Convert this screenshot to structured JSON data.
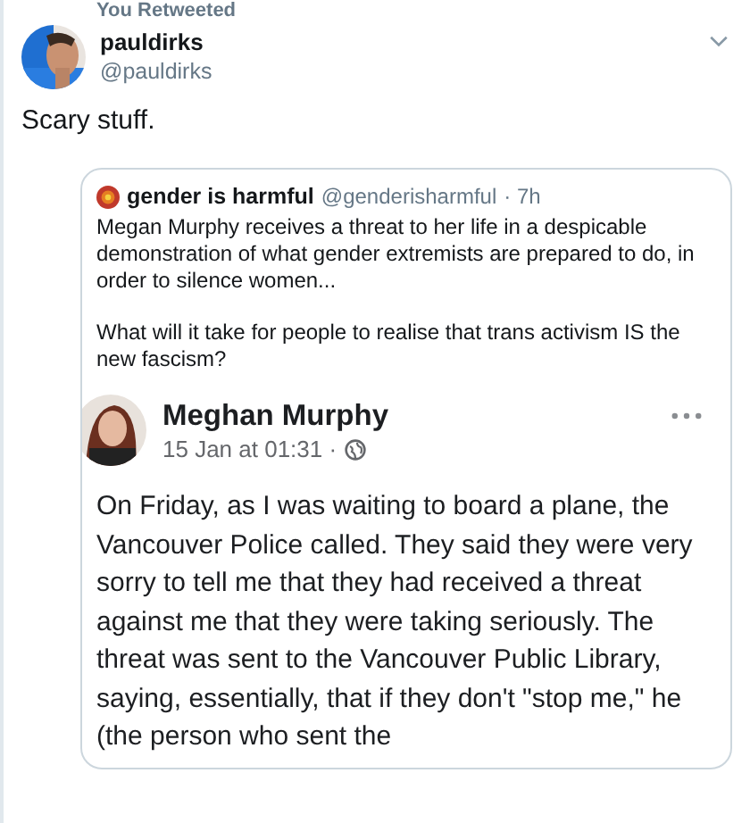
{
  "retweet_label": "You Retweeted",
  "tweet": {
    "name": "pauldirks",
    "handle": "@pauldirks",
    "text": "Scary stuff."
  },
  "quoted": {
    "name": "gender is harmful",
    "handle": "@genderisharmful",
    "time": "· 7h",
    "paragraphs": [
      "Megan Murphy receives a threat to her life in a despicable demonstration of what gender extremists are prepared to do, in order to silence women...",
      "What will it take for people to realise that trans activism IS the new fascism?"
    ],
    "post": {
      "name": "Meghan Murphy",
      "date": "15 Jan at 01:31 ·",
      "text": "On Friday, as I was waiting to board a plane, the Vancouver Police called. They said they were very sorry to tell me that they had received a threat against me that they were taking seriously. The threat was sent to the Vancouver Public Library, saying, essentially, that if they don't \"stop me,\" he (the person who sent the"
    }
  }
}
